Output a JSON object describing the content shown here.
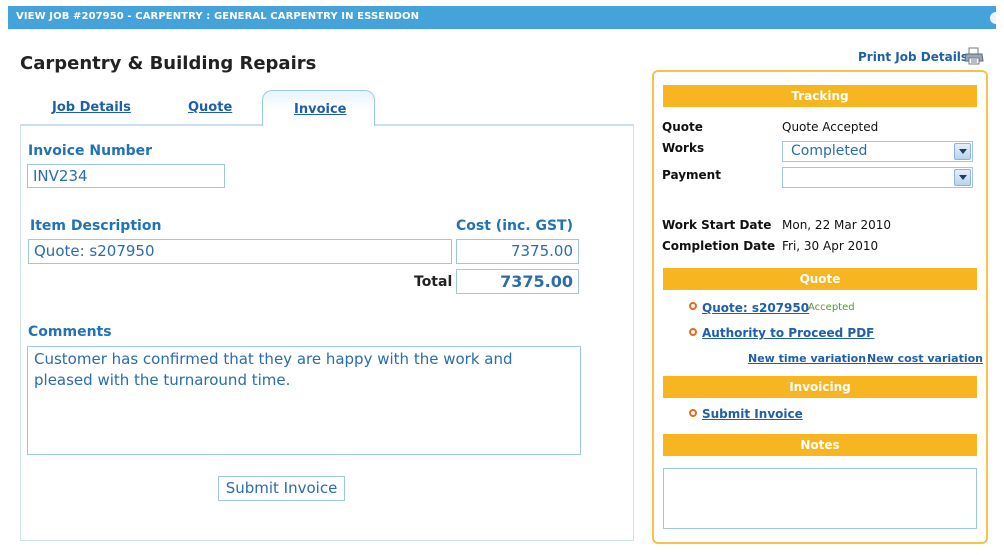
{
  "header": {
    "title": "VIEW JOB #207950 - CARPENTRY : GENERAL CARPENTRY IN ESSENDON"
  },
  "page": {
    "title": "Carpentry & Building Repairs"
  },
  "tabs": [
    {
      "label": "Job Details"
    },
    {
      "label": "Quote"
    },
    {
      "label": "Invoice",
      "active": true
    }
  ],
  "invoice": {
    "number_label": "Invoice Number",
    "number_value": "INV234",
    "item_header": "Item Description",
    "cost_header": "Cost (inc. GST)",
    "item_description": "Quote: s207950",
    "item_cost": "7375.00",
    "total_label": "Total",
    "total_value": "7375.00",
    "comments_label": "Comments",
    "comments_text": "Customer has confirmed that they are happy with the work and pleased with the turnaround time.",
    "submit_label": "Submit Invoice"
  },
  "sidebar": {
    "print_label": "Print Job Details",
    "tracking": {
      "title": "Tracking",
      "quote_label": "Quote",
      "quote_value": "Quote Accepted",
      "works_label": "Works",
      "works_value": "Completed",
      "payment_label": "Payment",
      "payment_value": "",
      "start_label": "Work Start Date",
      "start_value": "Mon, 22 Mar 2010",
      "completion_label": "Completion Date",
      "completion_value": "Fri, 30 Apr 2010"
    },
    "quote": {
      "title": "Quote",
      "quote_link": "Quote: s207950",
      "quote_status": "Accepted",
      "authority_link": "Authority to Proceed PDF",
      "time_variation": "New time variation",
      "cost_variation": "New cost variation"
    },
    "invoicing": {
      "title": "Invoicing",
      "submit_link": "Submit Invoice"
    },
    "notes": {
      "title": "Notes"
    }
  },
  "colors": {
    "header_bar": "#45a3dc",
    "section_head": "#f7b621",
    "link": "#1f5fa8",
    "label_blue": "#2173b5",
    "accepted_green": "#4da11a",
    "bullet_orange": "#e96a1e"
  }
}
